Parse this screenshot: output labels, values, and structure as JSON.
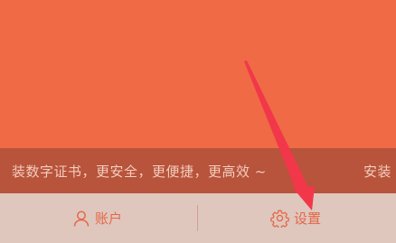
{
  "banner": {
    "marquee_text": "装数字证书，更安全，更便捷，更高效 ~",
    "marquee_next": "安装"
  },
  "tabbar": {
    "account_label": "账户",
    "settings_label": "设置"
  },
  "colors": {
    "hero": "#ef6a45",
    "marquee_bg": "#b7543b",
    "marquee_text": "#f4cdbf",
    "tabbar_bg": "#dfc7bd",
    "accent": "#e4674a",
    "annotation_arrow": "#f2374b"
  },
  "icons": {
    "account": "user-icon",
    "settings": "gear-icon",
    "annotation": "red-arrow-icon"
  }
}
